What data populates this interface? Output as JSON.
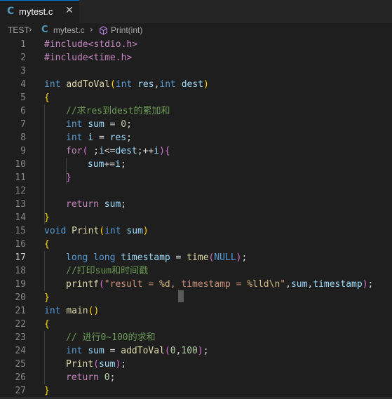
{
  "tab": {
    "icon": "C",
    "label": "mytest.c",
    "close": "✕"
  },
  "breadcrumb": {
    "root": "TEST",
    "file_icon": "C",
    "file": "mytest.c",
    "symbol": "Print(int)"
  },
  "editor": {
    "active_line": 17,
    "lines": [
      {
        "n": "1"
      },
      {
        "n": "2"
      },
      {
        "n": "3"
      },
      {
        "n": "4"
      },
      {
        "n": "5"
      },
      {
        "n": "6"
      },
      {
        "n": "7"
      },
      {
        "n": "8"
      },
      {
        "n": "9"
      },
      {
        "n": "10"
      },
      {
        "n": "11"
      },
      {
        "n": "12"
      },
      {
        "n": "13"
      },
      {
        "n": "14"
      },
      {
        "n": "15"
      },
      {
        "n": "16"
      },
      {
        "n": "17"
      },
      {
        "n": "18"
      },
      {
        "n": "19"
      },
      {
        "n": "20"
      },
      {
        "n": "21"
      },
      {
        "n": "22"
      },
      {
        "n": "23"
      },
      {
        "n": "24"
      },
      {
        "n": "25"
      },
      {
        "n": "26"
      },
      {
        "n": "27"
      }
    ],
    "code": {
      "l1": "#include<stdio.h>",
      "l2": "#include<time.h>",
      "l4_kw": "int",
      "l4_fn": "addToVal",
      "l4_p1k": "int",
      "l4_p1": "res",
      "l4_p2k": "int",
      "l4_p2": "dest",
      "l6": "//求res到dest的累加和",
      "l7_kw": "int",
      "l7_v": "sum",
      "l7_n": "0",
      "l8_kw": "int",
      "l8_v": "i",
      "l8_v2": "res",
      "l9_kw": "for",
      "l9_a": "i",
      "l9_b": "dest",
      "l9_c": "i",
      "l10_a": "sum",
      "l10_b": "i",
      "l13_kw": "return",
      "l13_v": "sum",
      "l15_kw": "void",
      "l15_fn": "Print",
      "l15_pk": "int",
      "l15_p": "sum",
      "l17_k1": "long",
      "l17_k2": "long",
      "l17_v": "timestamp",
      "l17_fn": "time",
      "l17_null": "NULL",
      "l18": "//打印sum和时间戳",
      "l19_fn": "printf",
      "l19_s1": "\"result = ",
      "l19_e1": "%d",
      "l19_s2": ", timestamp = ",
      "l19_e2": "%lld\\n",
      "l19_s3": "\"",
      "l19_a": "sum",
      "l19_b": "timestamp",
      "l21_kw": "int",
      "l21_fn": "main",
      "l23": "// 进行0~100的求和",
      "l24_kw": "int",
      "l24_v": "sum",
      "l24_fn": "addToVal",
      "l24_n1": "0",
      "l24_n2": "100",
      "l25_fn": "Print",
      "l25_v": "sum",
      "l26_kw": "return",
      "l26_n": "0"
    }
  },
  "colors": {
    "background": "#1e1e1e",
    "keyword": "#569cd6",
    "control": "#c586c0",
    "function": "#dcdcaa",
    "variable": "#9cdcfe",
    "number": "#b5cea8",
    "string": "#ce9178",
    "comment": "#6a9955"
  }
}
